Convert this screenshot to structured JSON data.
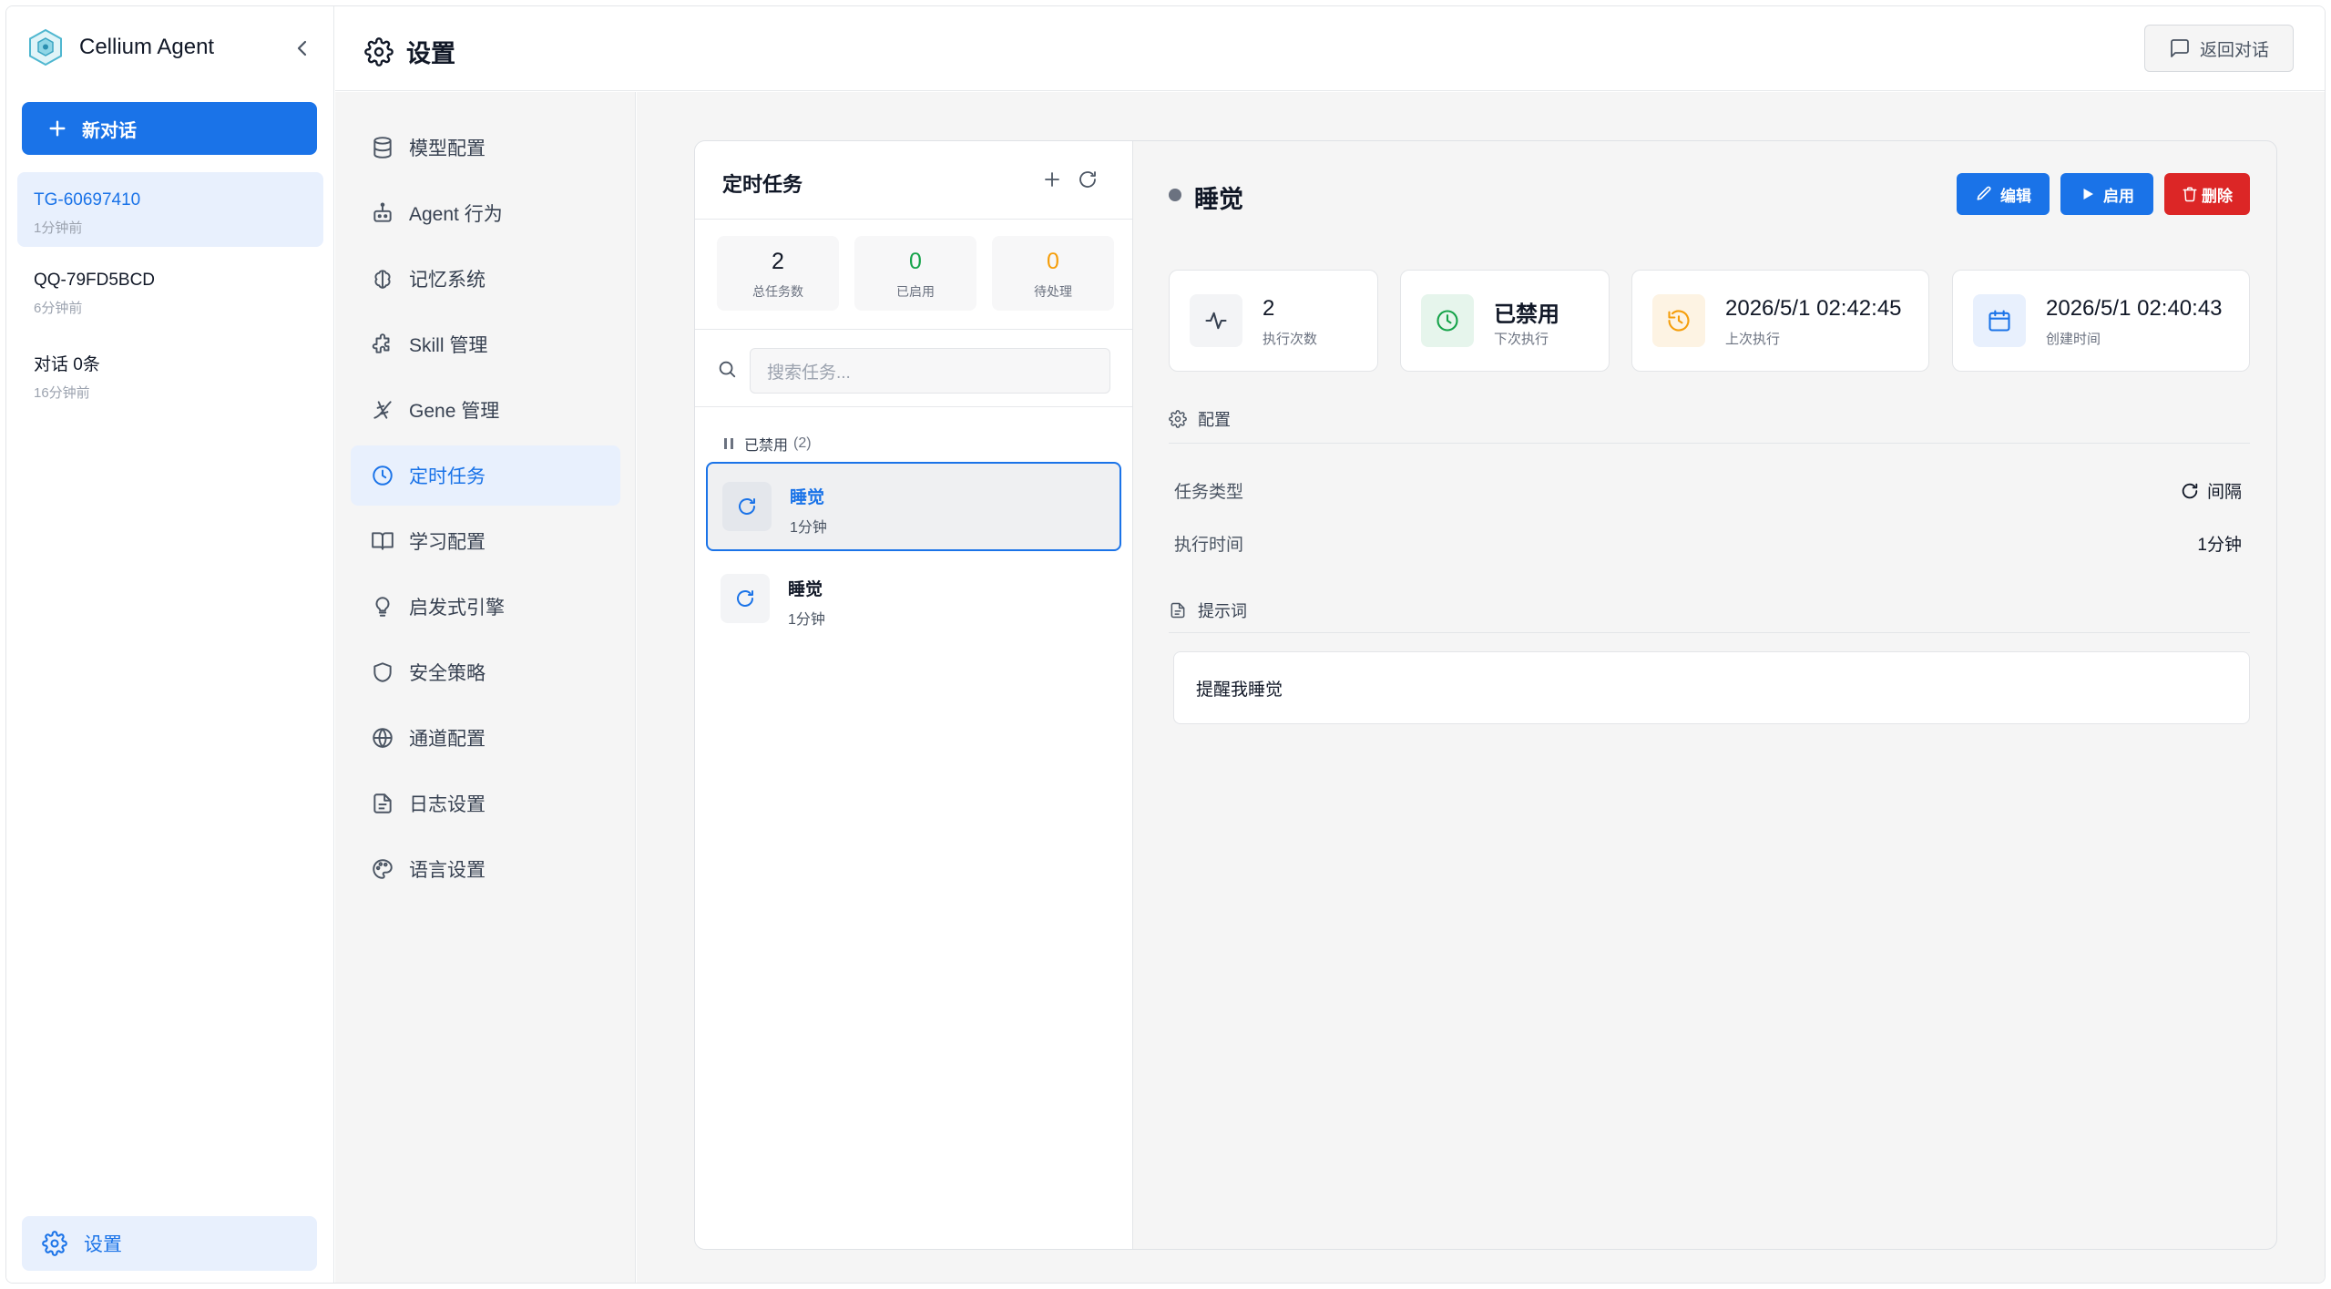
{
  "app": {
    "name": "Cellium Agent"
  },
  "sidebar": {
    "new_chat_label": "新对话",
    "conversations": [
      {
        "title": "TG-60697410",
        "time": "1分钟前"
      },
      {
        "title": "QQ-79FD5BCD",
        "time": "6分钟前"
      },
      {
        "title": "对话 0条",
        "time": "16分钟前"
      }
    ],
    "settings_label": "设置"
  },
  "header": {
    "title": "设置",
    "back_label": "返回对话"
  },
  "nav": {
    "items": [
      {
        "label": "模型配置",
        "icon": "database-icon"
      },
      {
        "label": "Agent 行为",
        "icon": "robot-icon"
      },
      {
        "label": "记忆系统",
        "icon": "brain-icon"
      },
      {
        "label": "Skill 管理",
        "icon": "puzzle-icon"
      },
      {
        "label": "Gene 管理",
        "icon": "dna-icon"
      },
      {
        "label": "定时任务",
        "icon": "clock-icon"
      },
      {
        "label": "学习配置",
        "icon": "book-icon"
      },
      {
        "label": "启发式引擎",
        "icon": "lightbulb-icon"
      },
      {
        "label": "安全策略",
        "icon": "shield-icon"
      },
      {
        "label": "通道配置",
        "icon": "globe-icon"
      },
      {
        "label": "日志设置",
        "icon": "file-text-icon"
      },
      {
        "label": "语言设置",
        "icon": "palette-icon"
      }
    ],
    "active_index": 5
  },
  "tasks": {
    "title": "定时任务",
    "stats": [
      {
        "value": "2",
        "label": "总任务数"
      },
      {
        "value": "0",
        "label": "已启用"
      },
      {
        "value": "0",
        "label": "待处理"
      }
    ],
    "search_placeholder": "搜索任务...",
    "group_label": "已禁用",
    "group_count": "(2)",
    "items": [
      {
        "name": "睡觉",
        "interval": "1分钟"
      },
      {
        "name": "睡觉",
        "interval": "1分钟"
      }
    ]
  },
  "detail": {
    "title": "睡觉",
    "buttons": {
      "edit": "编辑",
      "enable": "启用",
      "delete": "删除"
    },
    "cards": [
      {
        "value": "2",
        "label": "执行次数",
        "icon": "activity-icon"
      },
      {
        "value": "已禁用",
        "label": "下次执行",
        "icon": "clock-icon"
      },
      {
        "value": "2026/5/1 02:42:45",
        "label": "上次执行",
        "icon": "history-icon"
      },
      {
        "value": "2026/5/1 02:40:43",
        "label": "创建时间",
        "icon": "calendar-icon"
      }
    ],
    "config_title": "配置",
    "task_type_label": "任务类型",
    "task_type_value": "间隔",
    "exec_time_label": "执行时间",
    "exec_time_value": "1分钟",
    "prompt_title": "提示词",
    "prompt_text": "提醒我睡觉"
  },
  "colors": {
    "primary": "#1a73e8",
    "danger": "#dc2626",
    "success": "#16a34a",
    "warning": "#f59e0b"
  }
}
